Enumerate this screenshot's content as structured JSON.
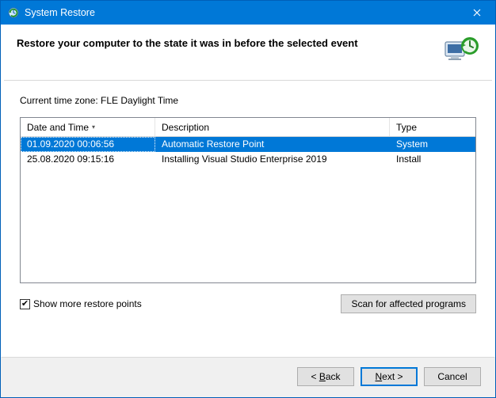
{
  "window": {
    "title": "System Restore"
  },
  "header": {
    "heading": "Restore your computer to the state it was in before the selected event"
  },
  "content": {
    "timezone_label": "Current time zone: FLE Daylight Time",
    "columns": {
      "date": "Date and Time",
      "desc": "Description",
      "type": "Type"
    },
    "sort": {
      "column": "date",
      "direction": "desc"
    },
    "rows": [
      {
        "date": "01.09.2020 00:06:56",
        "desc": "Automatic Restore Point",
        "type": "System",
        "selected": true
      },
      {
        "date": "25.08.2020 09:15:16",
        "desc": "Installing Visual Studio Enterprise 2019",
        "type": "Install",
        "selected": false
      }
    ],
    "checkbox": {
      "label": "Show more restore points",
      "checked": true
    },
    "scan_button": "Scan for affected programs"
  },
  "footer": {
    "back": "< Back",
    "next": "Next >",
    "cancel": "Cancel"
  },
  "colors": {
    "accent": "#0078d7"
  }
}
